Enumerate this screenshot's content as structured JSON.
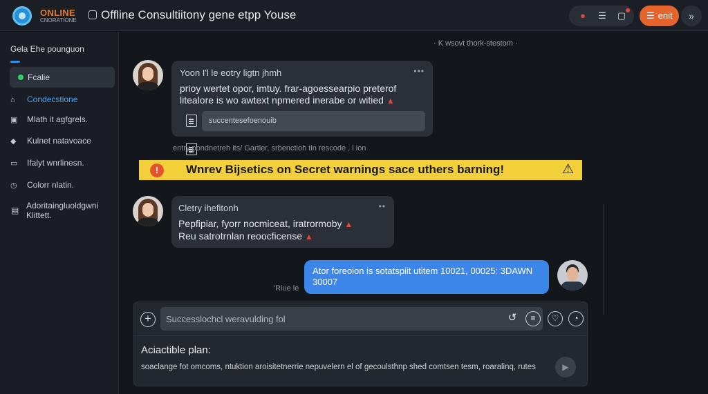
{
  "header": {
    "logo_line1": "ONLINE",
    "logo_line2": "CNORATIONE",
    "title": "Offline Consultiitony gene etpp Youse",
    "icons": [
      "record-icon",
      "list-icon",
      "chat-icon"
    ],
    "exit_label": "enit",
    "more_glyph": "»"
  },
  "sidebar": {
    "title": "Gela Ehe pounguon",
    "active_item": "Fcalie",
    "items": [
      {
        "label": "Condecstione",
        "icon": "chat-icon",
        "highlight": true
      },
      {
        "label": "Mlath it agfgrels.",
        "icon": "document-icon"
      },
      {
        "label": "Kulnet natavoace",
        "icon": "shield-icon"
      },
      {
        "label": "Ifalyt wnrlinesn.",
        "icon": "card-icon"
      },
      {
        "label": "Colorr nlatin.",
        "icon": "clock-icon"
      },
      {
        "label": "Adoritaingluoldgwni Klittett.",
        "icon": "clipboard-icon"
      }
    ]
  },
  "chat": {
    "timestamp": "· K wsovt thork-stestom ·",
    "message1": {
      "name": "Yoon I'l le eotry ligtn jhmh",
      "text": "prioy wertet opor, imtuy. frar-agoessearpio preterof litealore is wo awtext npmered inerabe or witied",
      "attachment": "succentesefoenouib",
      "meta": "entry pondnetreh its/ Gartler, srbenctioh tin rescode , l ion"
    },
    "banner": "Wnrev Bijsetics on Secret warnings sace uthers barning!",
    "message2": {
      "name": "Cletry ihefitonh",
      "line1": "Pepfipiar, fyorr nocmiceat, iratrormoby",
      "line2": "Reu satrotrnlan reoocficense"
    },
    "message3": {
      "text": "Ator foreoion is sotatspiit utitem 10021, 00025: 3DAWN 30007"
    },
    "reply_meta": "'Riue le"
  },
  "composer": {
    "placeholder": "Successlochcl weravulding fol",
    "plan_title": "Aciactible plan:",
    "plan_text": "soaclange fot omcoms, ntuktion aroisitetnerrie nepuvelern el of gecoulsthnp shed comtsen tesm, roaralinq, rutes"
  },
  "colors": {
    "accent": "#3b86e8",
    "exit": "#e4642c",
    "banner": "#f3d03a",
    "online": "#2fcf6a"
  }
}
